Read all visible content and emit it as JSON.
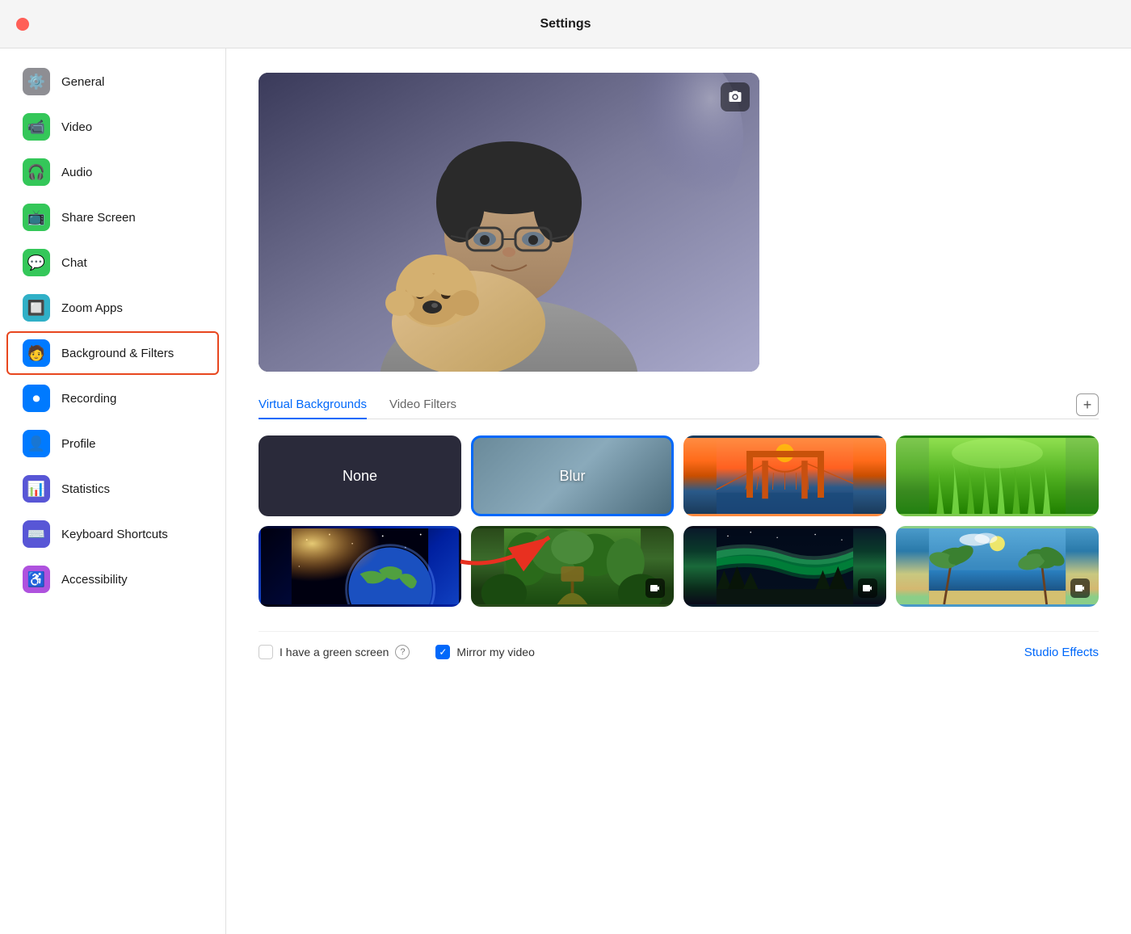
{
  "titleBar": {
    "title": "Settings"
  },
  "sidebar": {
    "items": [
      {
        "id": "general",
        "label": "General",
        "iconClass": "icon-gray",
        "iconSymbol": "⚙️",
        "active": false
      },
      {
        "id": "video",
        "label": "Video",
        "iconClass": "icon-green",
        "iconSymbol": "📹",
        "active": false
      },
      {
        "id": "audio",
        "label": "Audio",
        "iconClass": "icon-green",
        "iconSymbol": "🎧",
        "active": false
      },
      {
        "id": "share-screen",
        "label": "Share Screen",
        "iconClass": "icon-green",
        "iconSymbol": "📺",
        "active": false
      },
      {
        "id": "chat",
        "label": "Chat",
        "iconClass": "icon-green",
        "iconSymbol": "💬",
        "active": false
      },
      {
        "id": "zoom-apps",
        "label": "Zoom Apps",
        "iconClass": "icon-teal",
        "iconSymbol": "🔲",
        "active": false
      },
      {
        "id": "background-filters",
        "label": "Background & Filters",
        "iconClass": "icon-blue",
        "iconSymbol": "🧑",
        "active": true
      },
      {
        "id": "recording",
        "label": "Recording",
        "iconClass": "icon-blue",
        "iconSymbol": "⏺",
        "active": false
      },
      {
        "id": "profile",
        "label": "Profile",
        "iconClass": "icon-blue",
        "iconSymbol": "👤",
        "active": false
      },
      {
        "id": "statistics",
        "label": "Statistics",
        "iconClass": "icon-indigo",
        "iconSymbol": "📊",
        "active": false
      },
      {
        "id": "keyboard-shortcuts",
        "label": "Keyboard Shortcuts",
        "iconClass": "icon-indigo",
        "iconSymbol": "⌨️",
        "active": false
      },
      {
        "id": "accessibility",
        "label": "Accessibility",
        "iconClass": "icon-purple",
        "iconSymbol": "♿",
        "active": false
      }
    ]
  },
  "content": {
    "tabs": [
      {
        "id": "virtual-backgrounds",
        "label": "Virtual Backgrounds",
        "active": true
      },
      {
        "id": "video-filters",
        "label": "Video Filters",
        "active": false
      }
    ],
    "addButtonLabel": "+",
    "backgrounds": [
      {
        "id": "none",
        "label": "None",
        "type": "none",
        "selected": false
      },
      {
        "id": "blur",
        "label": "Blur",
        "type": "blur",
        "selected": true
      },
      {
        "id": "golden-gate",
        "label": "Golden Gate",
        "type": "golden-gate",
        "selected": false
      },
      {
        "id": "grass",
        "label": "Green Grass",
        "type": "grass",
        "selected": false
      },
      {
        "id": "earth",
        "label": "Earth from Space",
        "type": "earth",
        "selected": false
      },
      {
        "id": "jurassic",
        "label": "Jurassic Park",
        "type": "jurassic",
        "selected": false
      },
      {
        "id": "aurora",
        "label": "Aurora",
        "type": "aurora",
        "selected": false
      },
      {
        "id": "beach",
        "label": "Beach",
        "type": "beach",
        "selected": false
      }
    ],
    "greenScreen": {
      "label": "I have a green screen",
      "checked": false
    },
    "mirrorVideo": {
      "label": "Mirror my video",
      "checked": true
    },
    "studioEffects": {
      "label": "Studio Effects"
    }
  }
}
